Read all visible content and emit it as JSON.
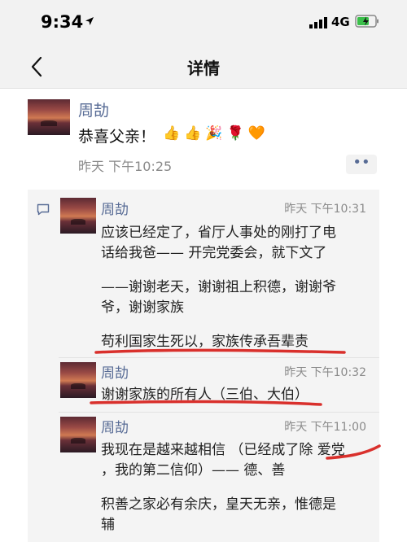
{
  "status_bar": {
    "time": "9:34",
    "network": "4G"
  },
  "nav": {
    "title": "详情"
  },
  "post": {
    "author": "周劼",
    "text": "恭喜父亲！",
    "emojis": [
      "👍",
      "👍",
      "🎉",
      "🌹",
      "🧡"
    ],
    "time": "昨天 下午10:25",
    "more": "••"
  },
  "comments": [
    {
      "author": "周劼",
      "time": "昨天 下午10:31",
      "lines": [
        "应该已经定了，省厅人事处的刚打了电",
        "话给我爸—— 开完党委会，就下文了",
        "——谢谢老天，谢谢祖上积德，谢谢爷",
        "爷，谢谢家族",
        "苟利国家生死以，家族传承吾辈责"
      ]
    },
    {
      "author": "周劼",
      "time": "昨天 下午10:32",
      "lines": [
        "谢谢家族的所有人（三伯、大伯）"
      ]
    },
    {
      "author": "周劼",
      "time": "昨天 下午11:00",
      "lines": [
        "我现在是越来越相信 （已经成了除 爱党",
        "，我的第二信仰）—— 德、善",
        "积善之家必有余庆，皇天无亲，惟德是",
        "辅"
      ]
    }
  ],
  "colors": {
    "link": "#576b95",
    "annotation": "#d9302c",
    "comment_bg": "#f4f4f4"
  }
}
